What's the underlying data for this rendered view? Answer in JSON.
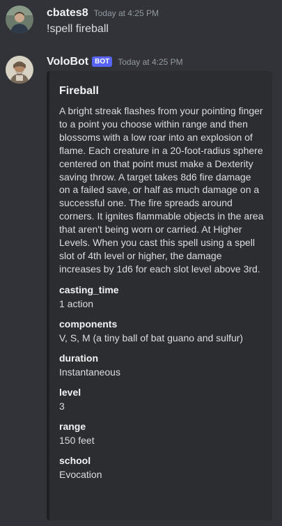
{
  "messages": [
    {
      "username": "cbates8",
      "timestamp": "Today at 4:25 PM",
      "content": "!spell fireball"
    },
    {
      "username": "VoloBot",
      "bot_tag": "BOT",
      "timestamp": "Today at 4:25 PM"
    }
  ],
  "embed": {
    "title": "Fireball",
    "description": "A bright streak flashes from your pointing finger to a point you choose within range and then blossoms with a low roar into an explosion of flame. Each creature in a 20-foot-radius sphere centered on that point must make a Dexterity saving throw. A target takes 8d6 fire damage on a failed save, or half as much damage on a successful one. The fire spreads around corners. It ignites flammable objects in the area that aren't being worn or carried. At Higher Levels. When you cast this spell using a spell slot of 4th level or higher, the damage increases by 1d6 for each slot level above 3rd.",
    "fields": [
      {
        "name": "casting_time",
        "value": "1 action"
      },
      {
        "name": "components",
        "value": "V, S, M (a tiny ball of bat guano and sulfur)"
      },
      {
        "name": "duration",
        "value": "Instantaneous"
      },
      {
        "name": "level",
        "value": "3"
      },
      {
        "name": "range",
        "value": "150 feet"
      },
      {
        "name": "school",
        "value": "Evocation"
      }
    ]
  },
  "colors": {
    "background": "#313338",
    "embed_background": "#2b2d31",
    "bot_tag": "#5865f2",
    "timestamp": "#949ba4"
  },
  "icons": {
    "user_avatar": "user-avatar-icon",
    "bot_avatar": "bot-avatar-icon"
  }
}
